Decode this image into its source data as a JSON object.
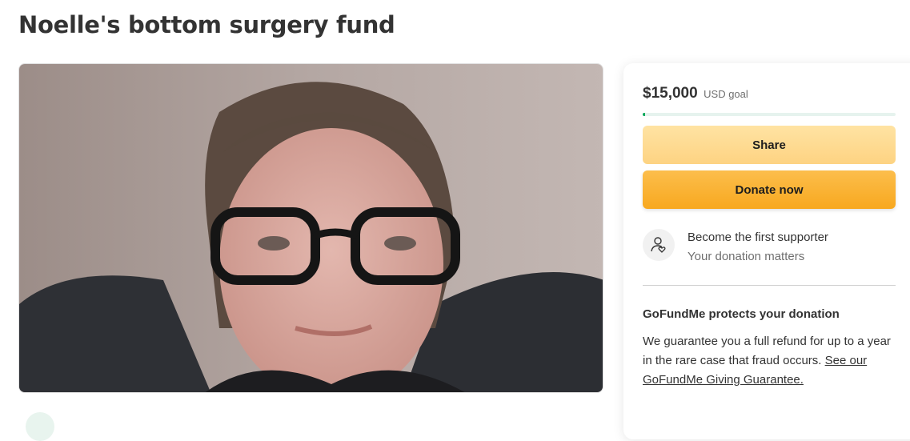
{
  "campaign": {
    "title": "Noelle's bottom surgery fund",
    "photo_alt": "Campaign photo"
  },
  "donation_card": {
    "goal_amount": "$15,000",
    "goal_label": "USD goal",
    "progress_fraction": 0.0,
    "share_label": "Share",
    "donate_label": "Donate now",
    "supporter_title": "Become the first supporter",
    "supporter_subtitle": "Your donation matters",
    "protect_title": "GoFundMe protects your donation",
    "protect_text": "We guarantee you a full refund for up to a year in the rare case that fraud occurs. ",
    "protect_link": "See our GoFundMe Giving Guarantee."
  },
  "colors": {
    "progress_fill": "#02a95c",
    "donate_button": "#f8a81f",
    "share_button": "#fdd382"
  }
}
